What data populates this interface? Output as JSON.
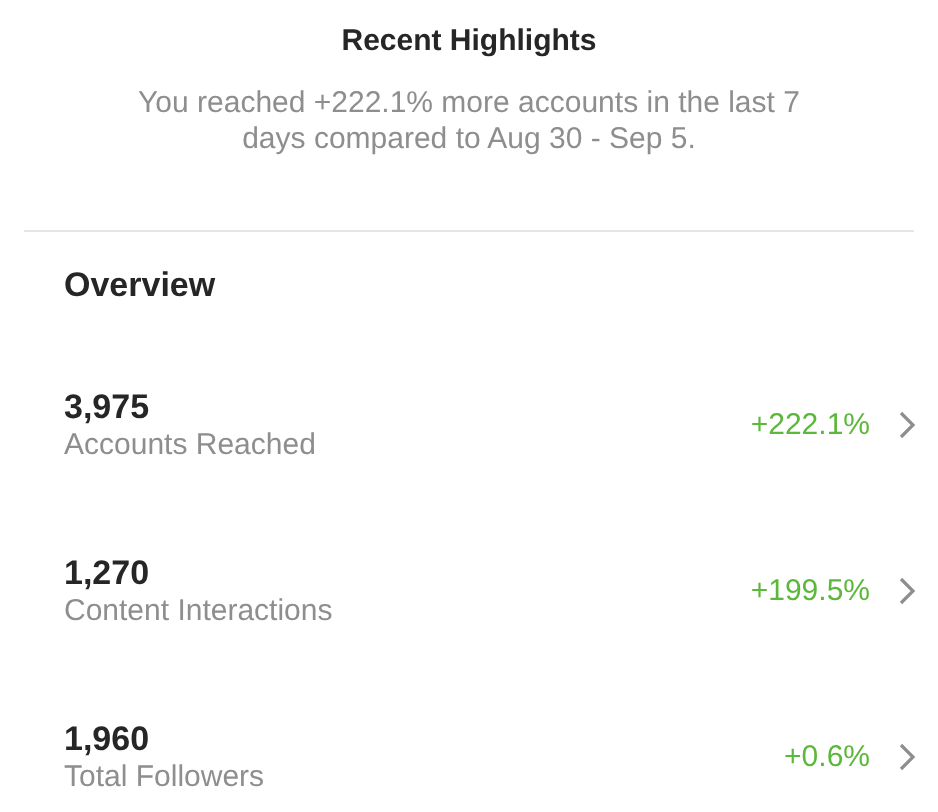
{
  "highlights": {
    "title": "Recent Highlights",
    "message": "You reached +222.1% more accounts in the last 7 days compared to Aug 30 - Sep 5."
  },
  "overview": {
    "title": "Overview",
    "metrics": [
      {
        "value": "3,975",
        "label": "Accounts Reached",
        "change": "+222.1%"
      },
      {
        "value": "1,270",
        "label": "Content Interactions",
        "change": "+199.5%"
      },
      {
        "value": "1,960",
        "label": "Total Followers",
        "change": "+0.6%"
      }
    ]
  }
}
